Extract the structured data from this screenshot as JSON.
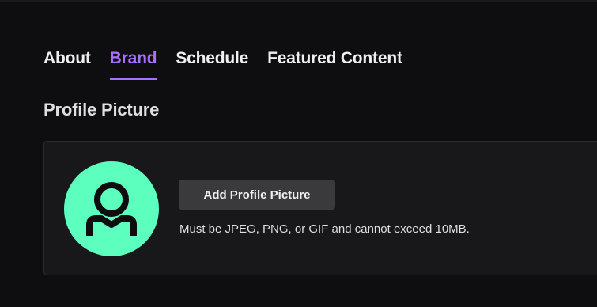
{
  "tabs": [
    {
      "label": "About",
      "active": false
    },
    {
      "label": "Brand",
      "active": true
    },
    {
      "label": "Schedule",
      "active": false
    },
    {
      "label": "Featured Content",
      "active": false
    }
  ],
  "profile_picture": {
    "title": "Profile Picture",
    "avatar_icon": "user-silhouette-icon",
    "avatar_color": "#5cffbe",
    "add_button_label": "Add Profile Picture",
    "hint": "Must be JPEG, PNG, or GIF and cannot exceed 10MB."
  },
  "colors": {
    "accent": "#a970ff",
    "background": "#0e0e10",
    "card": "#18181b",
    "button": "#3a3a3d"
  }
}
